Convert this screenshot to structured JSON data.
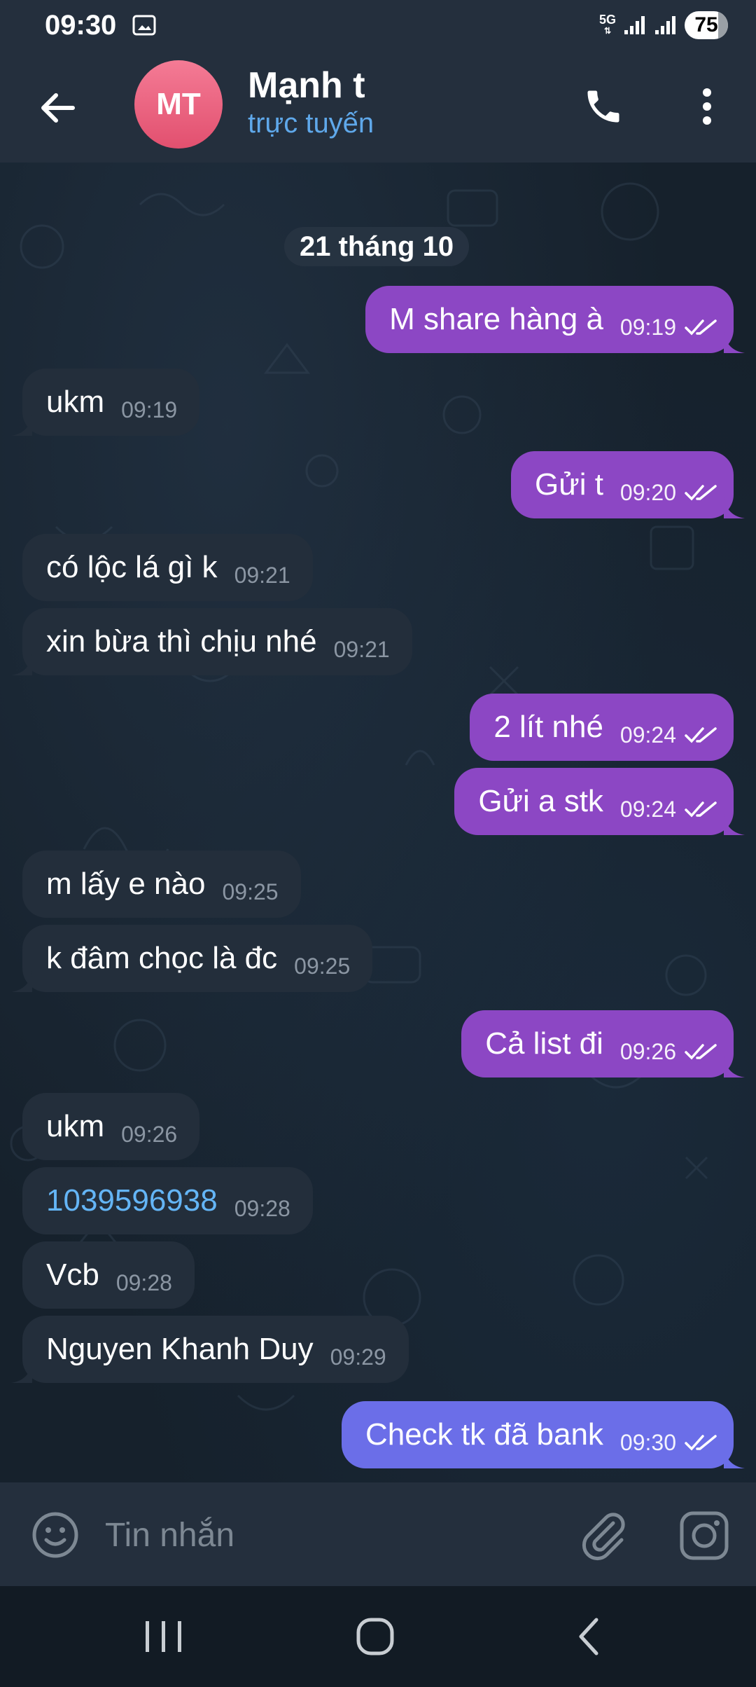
{
  "status_bar": {
    "time": "09:30",
    "network": "5G",
    "battery": "75"
  },
  "header": {
    "avatar_initials": "MT",
    "name": "Mạnh t",
    "status": "trực tuyến"
  },
  "chat": {
    "date_label": "21 tháng 10",
    "messages": [
      {
        "direction": "out",
        "text": "M share hàng à",
        "time": "09:19"
      },
      {
        "direction": "in",
        "text": "ukm",
        "time": "09:19"
      },
      {
        "direction": "out",
        "text": "Gửi t",
        "time": "09:20"
      },
      {
        "direction": "in",
        "text": "có lộc lá gì k",
        "time": "09:21"
      },
      {
        "direction": "in",
        "text": "xin bừa thì chịu nhé",
        "time": "09:21"
      },
      {
        "direction": "out",
        "text": "2 lít nhé",
        "time": "09:24"
      },
      {
        "direction": "out",
        "text": "Gửi a stk",
        "time": "09:24"
      },
      {
        "direction": "in",
        "text": "m lấy e nào",
        "time": "09:25"
      },
      {
        "direction": "in",
        "text": "k đâm chọc là đc",
        "time": "09:25"
      },
      {
        "direction": "out",
        "text": "Cả list đi",
        "time": "09:26"
      },
      {
        "direction": "in",
        "text": "ukm",
        "time": "09:26"
      },
      {
        "direction": "in",
        "text": "1039596938",
        "time": "09:28",
        "is_link": true
      },
      {
        "direction": "in",
        "text": "Vcb",
        "time": "09:28"
      },
      {
        "direction": "in",
        "text": "Nguyen Khanh Duy",
        "time": "09:29"
      },
      {
        "direction": "out",
        "text": "Check tk đã bank",
        "time": "09:30"
      }
    ]
  },
  "input": {
    "placeholder": "Tin nhắn"
  },
  "colors": {
    "header_bg": "#242f3d",
    "chat_bg": "#16212c",
    "incoming_bubble": "#232e3b",
    "outgoing_bubble": "#8c47c4",
    "outgoing_bubble_latest": "#6b6ee8",
    "link": "#64b5f6",
    "status_online": "#5fa8ea",
    "avatar": "#e95f7f"
  },
  "icons": {
    "back": "arrow-left-icon",
    "call": "phone-icon",
    "menu": "more-vertical-icon",
    "emoji": "emoji-icon",
    "attach": "paperclip-icon",
    "camera": "instagram-camera-icon",
    "read_receipt": "double-check-icon"
  }
}
